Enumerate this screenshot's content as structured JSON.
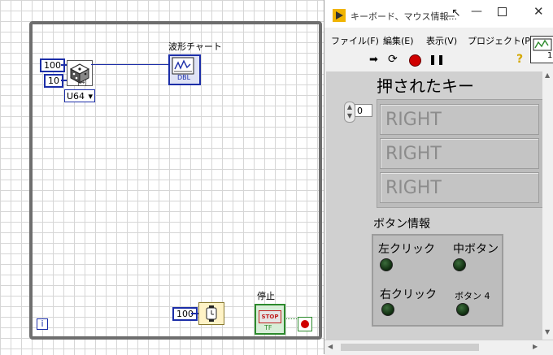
{
  "diagram": {
    "const_count": "100",
    "const_range": "10",
    "type_selector": "U64",
    "chart_label": "波形チャート",
    "chart_icon_text": "DBL",
    "wait_const": "100",
    "stop_label": "停止",
    "stop_button_text": "STOP",
    "stop_tf": "TF",
    "loop_index": "i"
  },
  "window": {
    "title": "キーボード、マウス情報...",
    "title_suffix": "ー",
    "menu": [
      "ファイル(F)",
      "編集(E)",
      "表示(V)",
      "プロジェクト(P)"
    ],
    "help_icon": "?",
    "icon_number": "1",
    "panel": {
      "key_title": "押されたキー",
      "index_value": "0",
      "keys": [
        "RIGHT",
        "RIGHT",
        "RIGHT"
      ],
      "button_info_title": "ボタン情報",
      "buttons": [
        "左クリック",
        "中ボタン",
        "右クリック",
        "ボタン 4"
      ]
    }
  },
  "colors": {
    "wire_blue": "#1c2ea8",
    "led_green": "#1f4a1f"
  }
}
